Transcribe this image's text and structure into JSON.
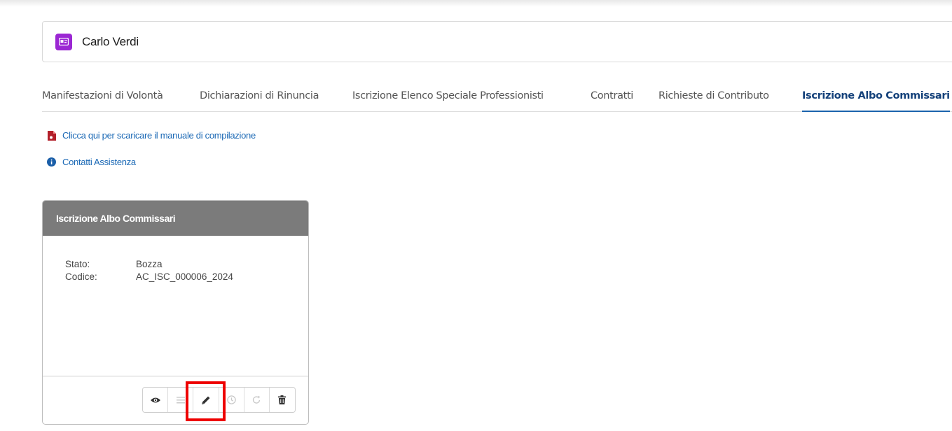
{
  "user": {
    "name": "Carlo Verdi",
    "badge_icon": "id-card-icon",
    "badge_color": "#9b27d3"
  },
  "tabs": [
    {
      "label": "Manifestazioni di Volontà",
      "active": false
    },
    {
      "label": "Dichiarazioni di Rinuncia",
      "active": false
    },
    {
      "label": "Iscrizione Elenco Speciale Professionisti",
      "active": false
    },
    {
      "label": "Contratti",
      "active": false
    },
    {
      "label": "Richieste di Contributo",
      "active": false
    },
    {
      "label": "Iscrizione Albo Commissari",
      "active": true
    }
  ],
  "links": {
    "manual": {
      "label": "Clicca qui per scaricare il manuale di compilazione",
      "icon": "pdf-icon"
    },
    "support": {
      "label": "Contatti Assistenza",
      "icon": "info-icon"
    }
  },
  "card": {
    "title": "Iscrizione Albo Commissari",
    "fields": [
      {
        "label": "Stato:",
        "value": "Bozza"
      },
      {
        "label": "Codice:",
        "value": "AC_ISC_000006_2024"
      }
    ],
    "actions": [
      "eye-icon",
      "list-icon",
      "pencil-icon",
      "clock-icon",
      "redo-icon",
      "trash-icon"
    ]
  },
  "colors": {
    "accent": "#1a68b5",
    "active_tab": "#14417a",
    "card_header": "#7b7b7b",
    "highlight": "#ee0000"
  }
}
